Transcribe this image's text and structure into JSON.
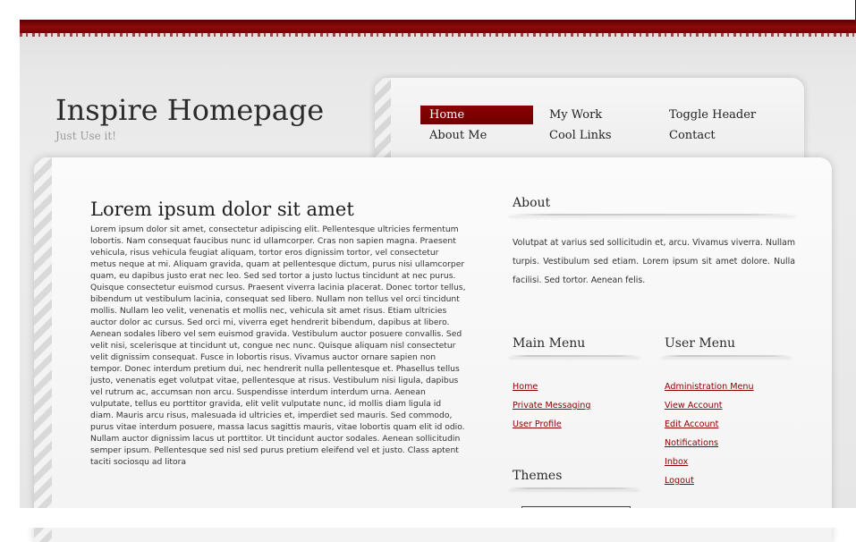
{
  "site": {
    "title": "Inspire Homepage",
    "slogan": "Just Use it!"
  },
  "nav": {
    "items": [
      {
        "label": "Home",
        "active": true
      },
      {
        "label": "About Me",
        "active": false
      },
      {
        "label": "My Work",
        "active": false
      },
      {
        "label": "Cool Links",
        "active": false
      },
      {
        "label": "Toggle Header",
        "active": false
      },
      {
        "label": "Contact",
        "active": false
      }
    ]
  },
  "main": {
    "heading": "Lorem ipsum dolor sit amet",
    "body": "Lorem ipsum dolor sit amet, consectetur adipiscing elit. Pellentesque ultricies fermentum lobortis. Nam consequat faucibus nunc id ullamcorper. Cras non sapien magna. Praesent vehicula, risus vehicula feugiat aliquam, tortor eros dignissim tortor, vel consectetur metus neque at mi. Aliquam gravida, quam at pellentesque dictum, purus nisi ullamcorper quam, eu dapibus justo erat nec leo. Sed sed tortor a justo luctus tincidunt at nec purus. Quisque consectetur euismod cursus. Praesent viverra lacinia placerat. Donec tortor tellus, bibendum ut vestibulum lacinia, consequat sed libero. Nullam non tellus vel orci tincidunt mollis. Nullam leo velit, venenatis et mollis nec, vehicula sit amet risus. Etiam ultricies auctor dolor ac cursus. Sed orci mi, viverra eget hendrerit bibendum, dapibus at libero. Aenean sodales libero vel sem euismod gravida. Vestibulum auctor posuere convallis. Sed velit nisi, scelerisque at tincidunt ut, congue nec nunc. Quisque aliquam nisl consectetur velit dignissim consequat. Fusce in lobortis risus. Vivamus auctor ornare sapien non tempor. Donec interdum pretium dui, nec hendrerit nulla pellentesque et. Phasellus tellus justo, venenatis eget volutpat vitae, pellentesque at risus. Vestibulum nisi ligula, dapibus vel rutrum ac, accumsan non arcu. Suspendisse interdum interdum urna. Aenean vulputate, tellus eu porttitor gravida, elit velit vulputate nunc, id mollis diam ligula id diam. Mauris arcu risus, malesuada id ultricies et, imperdiet sed mauris. Sed commodo, purus vitae interdum posuere, massa lacus sagittis mauris, vitae lobortis quam elit id odio. Nullam auctor dignissim lacus ut porttitor. Ut tincidunt auctor sodales. Aenean sollicitudin semper ipsum. Pellentesque sed nisl sed purus pretium eleifend vel et justo. Class aptent taciti sociosqu ad litora"
  },
  "sidebar": {
    "about": {
      "title": "About",
      "text": "Volutpat at varius sed sollicitudin et, arcu. Vivamus viverra. Nullam turpis. Vestibulum sed etiam. Lorem ipsum sit amet dolore. Nulla facilisi. Sed tortor. Aenean felis."
    },
    "main_menu": {
      "title": "Main Menu",
      "links": [
        "Home",
        "Private Messaging",
        "User Profile"
      ]
    },
    "user_menu": {
      "title": "User Menu",
      "links": [
        "Administration Menu",
        "View Account",
        "Edit Account",
        "Notifications",
        "Inbox",
        "Logout"
      ]
    },
    "themes": {
      "title": "Themes"
    }
  },
  "colors": {
    "accent_red": "#8b0000",
    "link_red": "#8b0000",
    "text_dark": "#2b2b2b"
  }
}
